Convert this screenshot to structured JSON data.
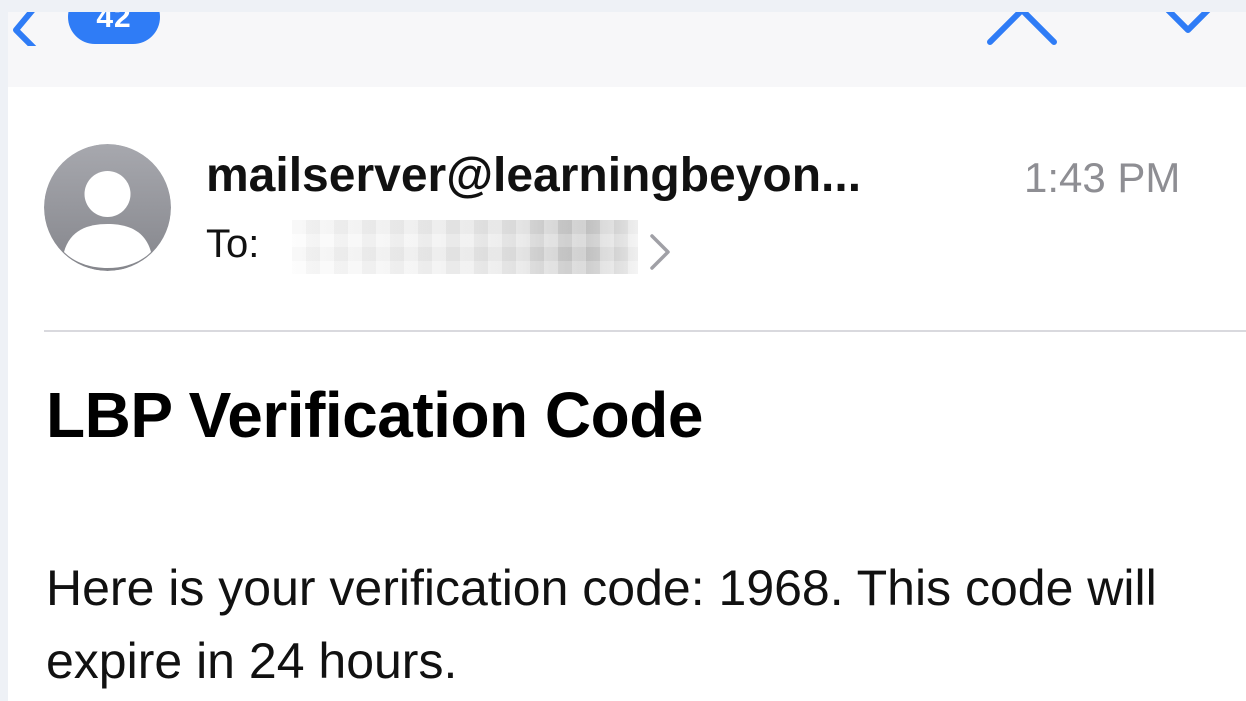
{
  "navbar": {
    "unread_count": "42",
    "back_icon": "chevron-left-icon",
    "prev_icon": "chevron-up-icon",
    "next_icon": "chevron-down-icon",
    "accent_color": "#2f7cf6"
  },
  "email": {
    "sender": "mailserver@learningbeyon...",
    "time": "1:43 PM",
    "to_label": "To:",
    "recipient_redacted": true,
    "subject": "LBP Verification Code",
    "body": "Here is your verification code: 1968. This code will expire in 24 hours."
  }
}
